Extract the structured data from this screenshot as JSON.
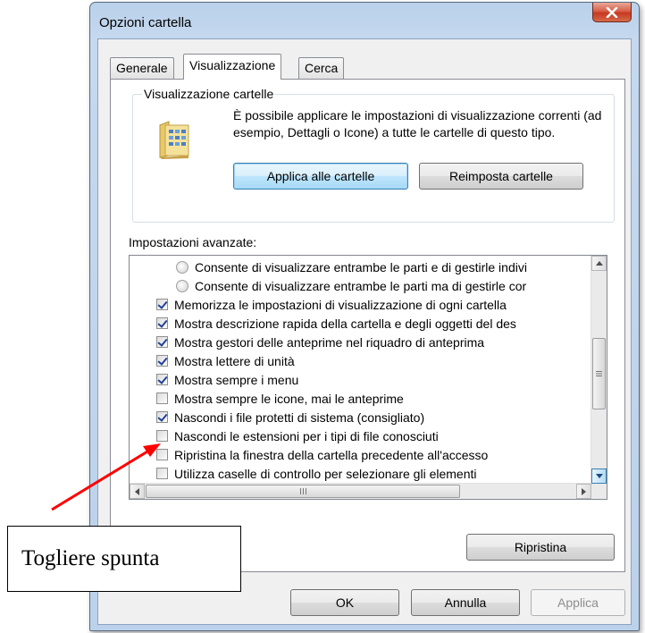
{
  "window": {
    "title": "Opzioni cartella",
    "close_glyph": "X"
  },
  "tabs": [
    {
      "label": "Generale",
      "active": false
    },
    {
      "label": "Visualizzazione",
      "active": true
    },
    {
      "label": "Cerca",
      "active": false
    }
  ],
  "folder_view": {
    "legend": "Visualizzazione cartelle",
    "description": "È possibile applicare le impostazioni di visualizzazione correnti (ad esempio, Dettagli o Icone) a tutte le cartelle di questo tipo.",
    "apply_button": "Applica alle cartelle",
    "reset_button": "Reimposta cartelle"
  },
  "advanced": {
    "label": "Impostazioni avanzate:",
    "items": [
      {
        "type": "radio",
        "checked": false,
        "label": "Consente di visualizzare entrambe le parti e di gestirle indivi"
      },
      {
        "type": "radio",
        "checked": false,
        "label": "Consente di visualizzare entrambe le parti ma di gestirle cor"
      },
      {
        "type": "checkbox",
        "checked": true,
        "label": "Memorizza le impostazioni di visualizzazione di ogni cartella"
      },
      {
        "type": "checkbox",
        "checked": true,
        "label": "Mostra descrizione rapida della cartella e degli oggetti del des"
      },
      {
        "type": "checkbox",
        "checked": true,
        "label": "Mostra gestori delle anteprime nel riquadro di anteprima"
      },
      {
        "type": "checkbox",
        "checked": true,
        "label": "Mostra lettere di unità"
      },
      {
        "type": "checkbox",
        "checked": true,
        "label": "Mostra sempre i menu"
      },
      {
        "type": "checkbox",
        "checked": false,
        "label": "Mostra sempre le icone, mai le anteprime"
      },
      {
        "type": "checkbox",
        "checked": true,
        "label": "Nascondi i file protetti di sistema (consigliato)"
      },
      {
        "type": "checkbox",
        "checked": false,
        "label": "Nascondi le estensioni per i tipi di file conosciuti"
      },
      {
        "type": "checkbox",
        "checked": false,
        "label": "Ripristina la finestra della cartella precedente all'accesso"
      },
      {
        "type": "checkbox",
        "checked": false,
        "label": "Utilizza caselle di controllo per selezionare gli elementi"
      }
    ],
    "restore_button": "Ripristina"
  },
  "footer": {
    "ok": "OK",
    "cancel": "Annulla",
    "apply": "Applica"
  },
  "annotation": {
    "text": "Togliere spunta",
    "arrow_color": "#ff0000"
  }
}
